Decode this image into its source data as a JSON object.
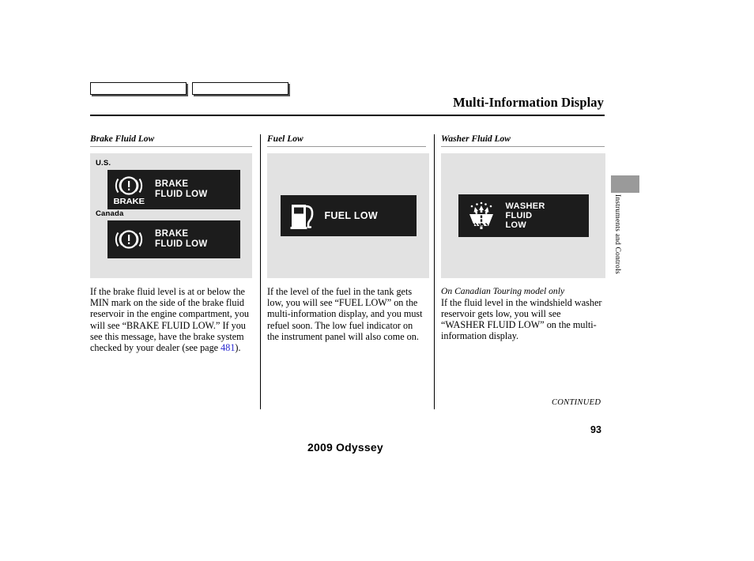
{
  "header": {
    "title": "Multi-Information Display"
  },
  "top_tabs": [
    {
      "label": ""
    },
    {
      "label": ""
    }
  ],
  "columns": [
    {
      "heading": "Brake Fluid Low",
      "figure": {
        "variants": [
          {
            "region": "U.S.",
            "icon": "brake-warning-icon",
            "icon_word": "BRAKE",
            "display_text": "BRAKE\nFLUID LOW"
          },
          {
            "region": "Canada",
            "icon": "brake-warning-icon",
            "icon_word": "",
            "display_text": "BRAKE\nFLUID LOW"
          }
        ]
      },
      "body": "If the brake fluid level is at or below the MIN mark on the side of the brake fluid reservoir in the engine compartment, you will see “BRAKE FLUID LOW.” If you see this message, have the brake system checked by your dealer (see page ",
      "page_ref": "481",
      "body_tail": ")."
    },
    {
      "heading": "Fuel Low",
      "figure": {
        "variants": [
          {
            "region": "",
            "icon": "fuel-pump-icon",
            "icon_word": "",
            "display_text": "FUEL LOW"
          }
        ]
      },
      "body": "If the level of the fuel in the tank gets low, you will see “FUEL LOW” on the multi-information display, and you must refuel soon. The low fuel indicator on the instrument panel will also come on."
    },
    {
      "heading": "Washer Fluid Low",
      "figure": {
        "variants": [
          {
            "region": "",
            "icon": "washer-fluid-icon",
            "icon_word": "",
            "display_text": "WASHER\nFLUID\nLOW"
          }
        ]
      },
      "note": "On Canadian Touring model only",
      "body": "If the fluid level in the windshield washer reservoir gets low, you will see “WASHER FLUID LOW” on the multi-information display."
    }
  ],
  "side_tab": {
    "label": "Instruments and Controls"
  },
  "footer": {
    "continued": "CONTINUED",
    "page_number": "93",
    "model": "2009  Odyssey"
  },
  "colors": {
    "page_background": "#ffffff",
    "figure_background": "#e2e2e2",
    "display_background": "#1c1c1c",
    "display_foreground": "#ffffff",
    "page_reference_link": "#2a2ad0",
    "side_tab": "#9a9a9a"
  }
}
